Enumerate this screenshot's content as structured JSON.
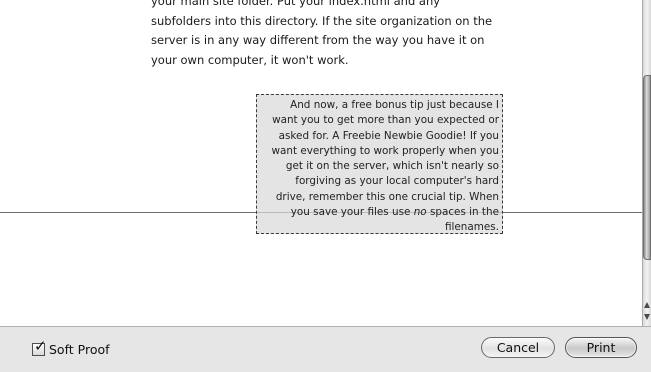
{
  "preview": {
    "body_text": "your main site folder. Put your index.html and any\nsubfolders into this directory. If the site organization on the\nserver is in any way different from the way you have it on\nyour own computer, it won't work.",
    "body_text_clipped_top": "p__ __ ___ ___ , ___ ___ ___ ___ ___",
    "tip_text_lines": [
      "And now, a free bonus tip just because I",
      "want you to get more than you expected or",
      "asked for. A Freebie Newbie Goodie! If you",
      "want everything to work properly when you",
      "get it on the server, which isn't nearly so",
      "forgiving as your local computer's hard",
      "drive, remember this one crucial tip. When",
      "you save your files use no spaces in the",
      "filenames."
    ],
    "tip_emphasis_word": "no"
  },
  "bottom_bar": {
    "soft_proof_label": "Soft Proof",
    "soft_proof_checked": true,
    "cancel_label": "Cancel",
    "print_label": "Print"
  },
  "colors": {
    "bar_background": "#e6e6e6",
    "tip_box_fill": "#dadada"
  },
  "icons": {
    "checkbox": "checkmark-icon",
    "scroll_up": "scroll-up-arrow-icon",
    "scroll_down": "scroll-down-arrow-icon"
  }
}
